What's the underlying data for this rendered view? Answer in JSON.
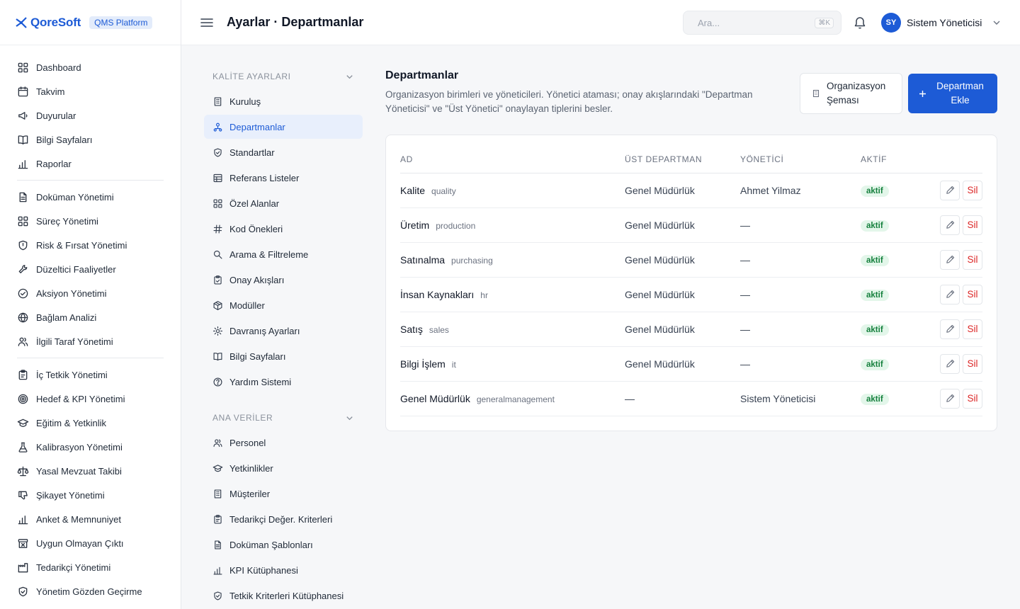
{
  "brand": {
    "name": "QoreSoft",
    "platform": "QMS Platform"
  },
  "sidebar": {
    "groups": [
      [
        {
          "label": "Dashboard",
          "icon": "grid-icon"
        },
        {
          "label": "Takvim",
          "icon": "calendar-icon"
        },
        {
          "label": "Duyurular",
          "icon": "megaphone-icon"
        },
        {
          "label": "Bilgi Sayfaları",
          "icon": "book-icon"
        },
        {
          "label": "Raporlar",
          "icon": "bar-chart-icon"
        }
      ],
      [
        {
          "label": "Doküman Yönetimi",
          "icon": "document-icon"
        },
        {
          "label": "Süreç Yönetimi",
          "icon": "grid-icon"
        },
        {
          "label": "Risk & Fırsat Yönetimi",
          "icon": "shield-icon"
        },
        {
          "label": "Düzeltici Faaliyetler",
          "icon": "wrench-icon"
        },
        {
          "label": "Aksiyon Yönetimi",
          "icon": "check-circle-icon"
        },
        {
          "label": "Bağlam Analizi",
          "icon": "globe-icon"
        },
        {
          "label": "İlgili Taraf Yönetimi",
          "icon": "users-icon"
        }
      ],
      [
        {
          "label": "İç Tetkik Yönetimi",
          "icon": "clipboard-icon"
        },
        {
          "label": "Hedef & KPI Yönetimi",
          "icon": "target-icon"
        },
        {
          "label": "Eğitim & Yetkinlik",
          "icon": "graduation-cap-icon"
        },
        {
          "label": "Kalibrasyon Yönetimi",
          "icon": "flask-icon"
        },
        {
          "label": "Yasal Mevzuat Takibi",
          "icon": "scale-icon"
        },
        {
          "label": "Şikayet Yönetimi",
          "icon": "thumbs-down-icon"
        },
        {
          "label": "Anket & Memnuniyet",
          "icon": "bar-chart-icon"
        },
        {
          "label": "Uygun Olmayan Çıktı",
          "icon": "archive-x-icon"
        },
        {
          "label": "Tedarikçi Yönetimi",
          "icon": "factory-icon"
        },
        {
          "label": "Yönetim Gözden Geçirme",
          "icon": "shield-check-icon"
        }
      ]
    ]
  },
  "topbar": {
    "title": "Ayarlar · Departmanlar",
    "search_placeholder": "Ara...",
    "search_shortcut": "⌘K",
    "user_initials": "SY",
    "user_name": "Sistem Yöneticisi"
  },
  "subnav": {
    "sections": [
      {
        "title": "KALİTE AYARLARI",
        "items": [
          {
            "label": "Kuruluş",
            "icon": "building-icon",
            "active": false
          },
          {
            "label": "Departmanlar",
            "icon": "org-chart-icon",
            "active": true
          },
          {
            "label": "Standartlar",
            "icon": "shield-check-icon",
            "active": false
          },
          {
            "label": "Referans Listeler",
            "icon": "table-icon",
            "active": false
          },
          {
            "label": "Özel Alanlar",
            "icon": "grid-icon",
            "active": false
          },
          {
            "label": "Kod Önekleri",
            "icon": "hash-icon",
            "active": false
          },
          {
            "label": "Arama & Filtreleme",
            "icon": "search-icon",
            "active": false
          },
          {
            "label": "Onay Akışları",
            "icon": "clipboard-check-icon",
            "active": false
          },
          {
            "label": "Modüller",
            "icon": "package-icon",
            "active": false
          },
          {
            "label": "Davranış Ayarları",
            "icon": "gear-icon",
            "active": false
          },
          {
            "label": "Bilgi Sayfaları",
            "icon": "book-icon",
            "active": false
          },
          {
            "label": "Yardım Sistemi",
            "icon": "help-circle-icon",
            "active": false
          }
        ]
      },
      {
        "title": "ANA VERİLER",
        "items": [
          {
            "label": "Personel",
            "icon": "users-icon",
            "active": false
          },
          {
            "label": "Yetkinlikler",
            "icon": "graduation-cap-icon",
            "active": false
          },
          {
            "label": "Müşteriler",
            "icon": "building-icon",
            "active": false
          },
          {
            "label": "Tedarikçi Değer. Kriterleri",
            "icon": "clipboard-icon",
            "active": false
          },
          {
            "label": "Doküman Şablonları",
            "icon": "document-icon",
            "active": false
          },
          {
            "label": "KPI Kütüphanesi",
            "icon": "bar-chart-icon",
            "active": false
          },
          {
            "label": "Tetkik Kriterleri Kütüphanesi",
            "icon": "shield-check-icon",
            "active": false
          }
        ]
      }
    ]
  },
  "main": {
    "title": "Departmanlar",
    "description": "Organizasyon birimleri ve yöneticileri. Yönetici ataması; onay akışlarındaki \"Departman Yöneticisi\" ve \"Üst Yönetici\" onaylayan tiplerini besler.",
    "org_button": "Organizasyon Şeması",
    "add_button": "Departman Ekle",
    "table": {
      "columns": [
        "AD",
        "ÜST DEPARTMAN",
        "YÖNETİCİ",
        "AKTİF"
      ],
      "delete_label": "Sil",
      "rows": [
        {
          "name": "Kalite",
          "code": "quality",
          "parent": "Genel Müdürlük",
          "manager": "Ahmet Yilmaz",
          "status": "aktif"
        },
        {
          "name": "Üretim",
          "code": "production",
          "parent": "Genel Müdürlük",
          "manager": "—",
          "status": "aktif"
        },
        {
          "name": "Satınalma",
          "code": "purchasing",
          "parent": "Genel Müdürlük",
          "manager": "—",
          "status": "aktif"
        },
        {
          "name": "İnsan Kaynakları",
          "code": "hr",
          "parent": "Genel Müdürlük",
          "manager": "—",
          "status": "aktif"
        },
        {
          "name": "Satış",
          "code": "sales",
          "parent": "Genel Müdürlük",
          "manager": "—",
          "status": "aktif"
        },
        {
          "name": "Bilgi İşlem",
          "code": "it",
          "parent": "Genel Müdürlük",
          "manager": "—",
          "status": "aktif"
        },
        {
          "name": "Genel Müdürlük",
          "code": "generalmanagement",
          "parent": "—",
          "manager": "Sistem Yöneticisi",
          "status": "aktif"
        }
      ]
    }
  },
  "colors": {
    "accent": "#1d5bd6",
    "danger": "#dc2626",
    "success": "#15803d"
  }
}
